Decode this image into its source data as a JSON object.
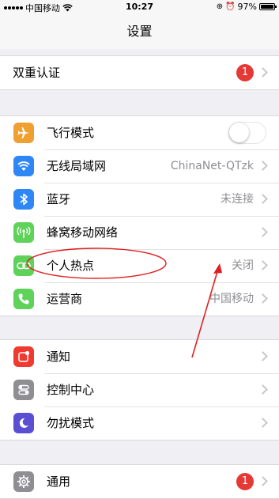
{
  "status_bar": {
    "carrier": "中国移动",
    "time": "10:27",
    "battery": "97%",
    "battery_level": 0.97
  },
  "nav": {
    "title": "设置"
  },
  "group_top": {
    "items": [
      {
        "label": "双重认证",
        "badge": "1"
      }
    ]
  },
  "group_network": {
    "items": [
      {
        "label": "飞行模式",
        "icon": "airplane-icon",
        "color": "#f0a030",
        "toggle_on": false
      },
      {
        "label": "无线局域网",
        "icon": "wifi-icon",
        "color": "#2f86f5",
        "value": "ChinaNet-QTzk"
      },
      {
        "label": "蓝牙",
        "icon": "bluetooth-icon",
        "color": "#2f86f5",
        "value": "未连接"
      },
      {
        "label": "蜂窝移动网络",
        "icon": "cellular-antenna-icon",
        "color": "#5fd25a"
      },
      {
        "label": "个人热点",
        "icon": "hotspot-link-icon",
        "color": "#5fd25a",
        "value": "关闭"
      },
      {
        "label": "运营商",
        "icon": "phone-icon",
        "color": "#5fd25a",
        "value": "中国移动"
      }
    ]
  },
  "group_system": {
    "items": [
      {
        "label": "通知",
        "icon": "notification-icon",
        "color": "#f03a30"
      },
      {
        "label": "控制中心",
        "icon": "control-center-icon",
        "color": "#8e8e93"
      },
      {
        "label": "勿扰模式",
        "icon": "moon-icon",
        "color": "#5a4fd3"
      }
    ]
  },
  "group_general": {
    "items": [
      {
        "label": "通用",
        "icon": "gear-icon",
        "color": "#8e8e93",
        "badge": "1"
      }
    ]
  },
  "annotation_color": "#e02020"
}
